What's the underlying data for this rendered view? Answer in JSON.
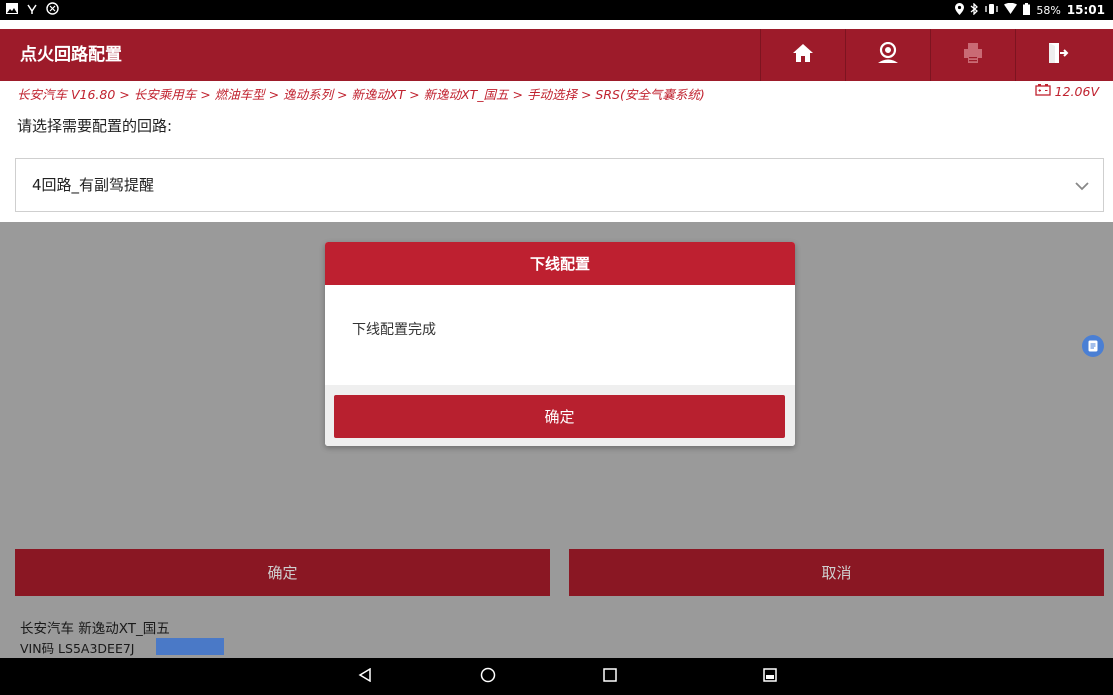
{
  "status_bar": {
    "battery": "58%",
    "time": "15:01"
  },
  "header": {
    "title": "点火回路配置",
    "buttons": [
      "home-icon",
      "user-icon",
      "print-icon",
      "exit-icon"
    ]
  },
  "breadcrumb": {
    "path": "长安汽车 V16.80 > 长安乘用车 > 燃油车型 > 逸动系列 > 新逸动XT > 新逸动XT_国五 > 手动选择 > SRS(安全气囊系统)",
    "voltage": "12.06V"
  },
  "main": {
    "prompt": "请选择需要配置的回路:",
    "selected_circuit": "4回路_有副驾提醒"
  },
  "actions": {
    "confirm_label": "确定",
    "cancel_label": "取消"
  },
  "vehicle": {
    "name": "长安汽车 新逸动XT_国五",
    "vin": "VIN码 LS5A3DEE7J"
  },
  "dialog": {
    "title": "下线配置",
    "message": "下线配置完成",
    "ok_label": "确定"
  },
  "colors": {
    "brand_red": "#9d1b2a",
    "dialog_red": "#be2030",
    "float_blue": "#4a7fd4"
  }
}
